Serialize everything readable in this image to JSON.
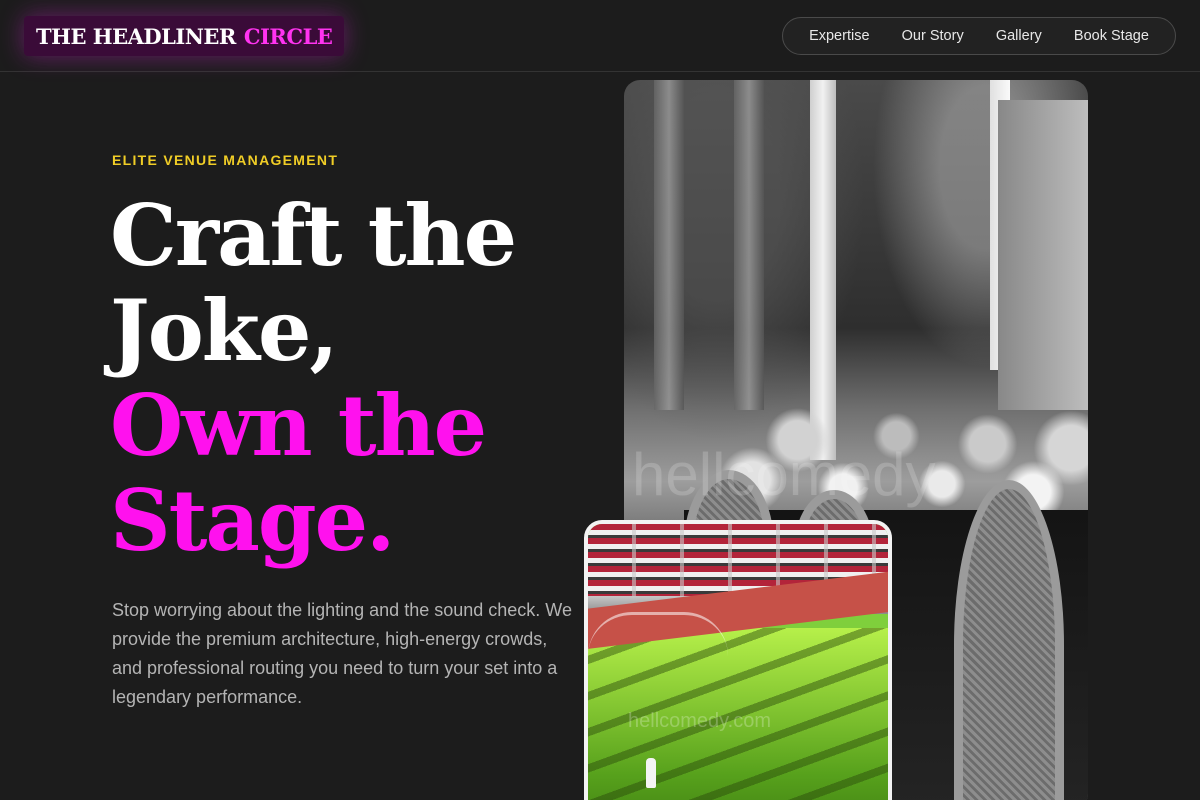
{
  "header": {
    "logo": {
      "part1": "THE HEADLINER",
      "part2": "CIRCLE"
    },
    "nav": [
      "Expertise",
      "Our Story",
      "Gallery",
      "Book Stage"
    ]
  },
  "hero": {
    "eyebrow": "ELITE VENUE MANAGEMENT",
    "headline": {
      "line1": "Craft the",
      "line2": "Joke,",
      "line3": "Own the",
      "line4": "Stage."
    },
    "description": "Stop worrying about the lighting and the sound check. We provide the premium architecture, high-energy crowds, and professional routing you need to turn your set into a legendary performance."
  },
  "images": {
    "venue_watermark": "hellcomedy",
    "stadium_watermark": "hellcomedy.com"
  },
  "colors": {
    "background": "#1c1c1c",
    "accent_pink": "#ff11ee",
    "accent_yellow": "#f0cd26",
    "logo_bg": "#3a0b38"
  }
}
